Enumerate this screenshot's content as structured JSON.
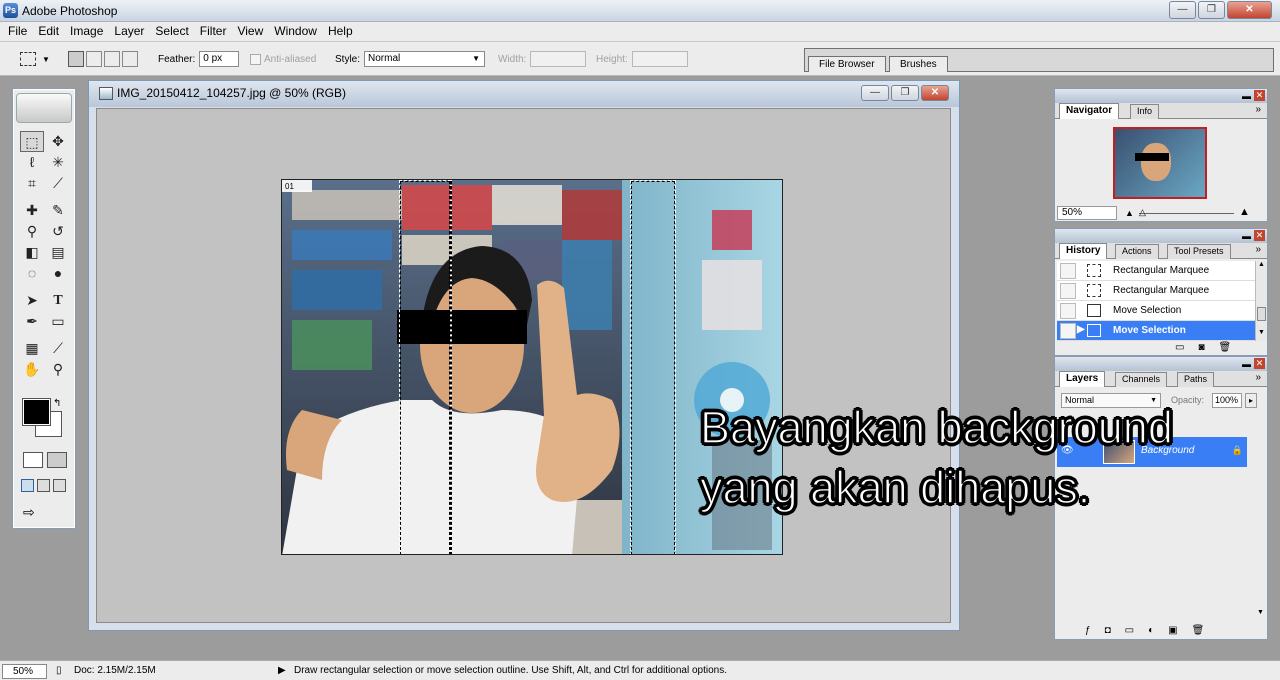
{
  "app": {
    "title": "Adobe Photoshop",
    "logo": "Ps"
  },
  "window_buttons": {
    "minimize": "—",
    "restore": "❐",
    "close": "✕"
  },
  "menu": [
    "File",
    "Edit",
    "Image",
    "Layer",
    "Select",
    "Filter",
    "View",
    "Window",
    "Help"
  ],
  "options": {
    "feather_label": "Feather:",
    "feather_value": "0 px",
    "antialias_label": "Anti-aliased",
    "style_label": "Style:",
    "style_value": "Normal",
    "width_label": "Width:",
    "height_label": "Height:"
  },
  "well_tabs": [
    "File Browser",
    "Brushes"
  ],
  "document": {
    "title": "IMG_20150412_104257.jpg @ 50% (RGB)",
    "corner_badge": "01"
  },
  "navigator": {
    "tabs": [
      "Navigator",
      "Info"
    ],
    "zoom": "50%"
  },
  "history": {
    "tabs": [
      "History",
      "Actions",
      "Tool Presets"
    ],
    "items": [
      {
        "label": "Rectangular Marquee"
      },
      {
        "label": "Rectangular Marquee"
      },
      {
        "label": "Move Selection"
      },
      {
        "label": "Move Selection"
      }
    ]
  },
  "layers": {
    "tabs": [
      "Layers",
      "Channels",
      "Paths"
    ],
    "blend_mode": "Normal",
    "opacity_label": "Opacity:",
    "opacity_value": "100%",
    "layer_name": "Background"
  },
  "caption": {
    "line1": "Bayangkan background",
    "line2": "yang akan dihapus."
  },
  "status": {
    "zoom": "50%",
    "doc": "Doc: 2.15M/2.15M",
    "hint": "Draw rectangular selection or move selection outline.  Use Shift, Alt, and Ctrl for additional options."
  },
  "colors": {
    "accent": "#3a7ef5",
    "window_title_gradient": "#b9c7d9",
    "canvas_gray": "#c2c2c2"
  }
}
